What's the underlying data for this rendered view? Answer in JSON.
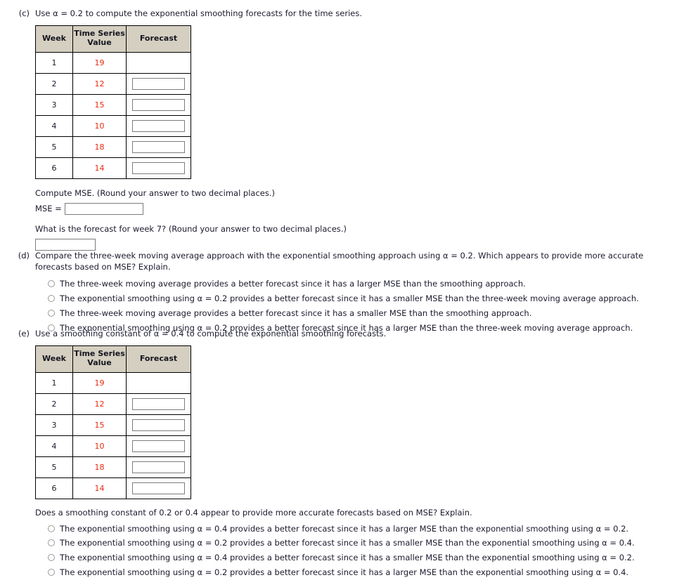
{
  "colors": {
    "header_fill": "#d4cfc0",
    "value_red": "#e82a0c",
    "text": "#1a1a2e",
    "box_border": "#7c7c7c",
    "radio_border": "#9a9a9a"
  },
  "part_c": {
    "label": "(c)",
    "prompt": "Use α = 0.2 to compute the exponential smoothing forecasts for the time series.",
    "table": {
      "headers": [
        "Week",
        "Time Series Value",
        "Forecast"
      ],
      "header_week": "Week",
      "header_tsv_line1": "Time Series",
      "header_tsv_line2": "Value",
      "header_forecast": "Forecast",
      "rows": [
        {
          "week": "1",
          "value": "19",
          "forecast": "",
          "has_input": false
        },
        {
          "week": "2",
          "value": "12",
          "forecast": "",
          "has_input": true
        },
        {
          "week": "3",
          "value": "15",
          "forecast": "",
          "has_input": true
        },
        {
          "week": "4",
          "value": "10",
          "forecast": "",
          "has_input": true
        },
        {
          "week": "5",
          "value": "18",
          "forecast": "",
          "has_input": true
        },
        {
          "week": "6",
          "value": "14",
          "forecast": "",
          "has_input": true
        }
      ]
    },
    "mse_prompt": "Compute MSE. (Round your answer to two decimal places.)",
    "mse_label": "MSE =",
    "mse_value": "",
    "week7_prompt": "What is the forecast for week 7? (Round your answer to two decimal places.)",
    "week7_value": ""
  },
  "part_d": {
    "label": "(d)",
    "prompt": "Compare the three-week moving average approach with the exponential smoothing approach using α = 0.2. Which appears to provide more accurate forecasts based on MSE? Explain.",
    "options": [
      "The three-week moving average provides a better forecast since it has a larger MSE than the smoothing approach.",
      "The exponential smoothing using α = 0.2 provides a better forecast since it has a smaller MSE than the three-week moving average approach.",
      "The three-week moving average provides a better forecast since it has a smaller MSE than the smoothing approach.",
      "The exponential smoothing using α = 0.2 provides a better forecast since it has a larger MSE than the three-week moving average approach."
    ],
    "selected": null
  },
  "part_e": {
    "label": "(e)",
    "prompt": "Use a smoothing constant of α = 0.4 to compute the exponential smoothing forecasts.",
    "table": {
      "headers": [
        "Week",
        "Time Series Value",
        "Forecast"
      ],
      "header_week": "Week",
      "header_tsv_line1": "Time Series",
      "header_tsv_line2": "Value",
      "header_forecast": "Forecast",
      "rows": [
        {
          "week": "1",
          "value": "19",
          "forecast": "",
          "has_input": false
        },
        {
          "week": "2",
          "value": "12",
          "forecast": "",
          "has_input": true
        },
        {
          "week": "3",
          "value": "15",
          "forecast": "",
          "has_input": true
        },
        {
          "week": "4",
          "value": "10",
          "forecast": "",
          "has_input": true
        },
        {
          "week": "5",
          "value": "18",
          "forecast": "",
          "has_input": true
        },
        {
          "week": "6",
          "value": "14",
          "forecast": "",
          "has_input": true
        }
      ]
    },
    "question": "Does a smoothing constant of 0.2 or 0.4 appear to provide more accurate forecasts based on MSE? Explain.",
    "options": [
      "The exponential smoothing using α = 0.4 provides a better forecast since it has a larger MSE than the exponential smoothing using α = 0.2.",
      "The exponential smoothing using α = 0.2 provides a better forecast since it has a smaller MSE than the exponential smoothing using α = 0.4.",
      "The exponential smoothing using α = 0.4 provides a better forecast since it has a smaller MSE than the exponential smoothing using α = 0.2.",
      "The exponential smoothing using α = 0.2 provides a better forecast since it has a larger MSE than the exponential smoothing using α = 0.4."
    ],
    "selected": null
  }
}
